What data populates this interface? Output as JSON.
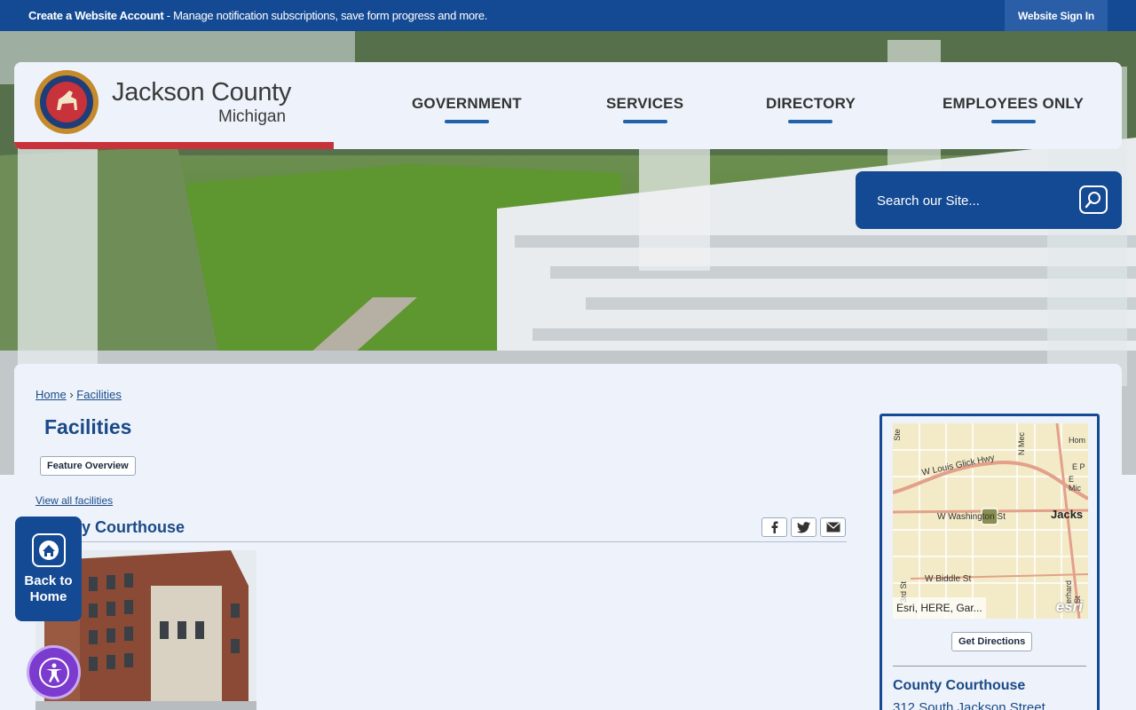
{
  "topbar": {
    "create_account_bold": "Create a Website Account",
    "create_account_rest": " - Manage notification subscriptions, save form progress and more.",
    "sign_in": "Website Sign In"
  },
  "brand": {
    "title": "Jackson County",
    "subtitle": "Michigan"
  },
  "nav": {
    "items": [
      {
        "label": "GOVERNMENT"
      },
      {
        "label": "SERVICES"
      },
      {
        "label": "DIRECTORY"
      },
      {
        "label": "EMPLOYEES ONLY"
      }
    ]
  },
  "search": {
    "placeholder": "Search our Site..."
  },
  "breadcrumb": {
    "home": "Home",
    "separator": "›",
    "current": "Facilities"
  },
  "page": {
    "title": "Facilities",
    "feature_overview": "Feature Overview",
    "view_all": "View all facilities",
    "facility_title": "County Courthouse"
  },
  "sidebar": {
    "map": {
      "labels": [
        "W Louis Glick Hwy",
        "W Washington St",
        "Jacks",
        "W Biddle St",
        "N Mec",
        "Hom",
        "E P",
        "E Mic",
        "Ste",
        "3rd St",
        "erhard St"
      ],
      "attribution": "Esri, HERE, Gar...",
      "esri": "esri"
    },
    "get_directions": "Get Directions",
    "facility_name": "County Courthouse",
    "address": "312 South Jackson Street"
  },
  "back_home": {
    "line1": "Back to",
    "line2": "Home"
  },
  "colors": {
    "primary": "#144a93",
    "accent_red": "#c8323a",
    "link": "#1a4a86",
    "accessibility": "#7c3bcf"
  }
}
